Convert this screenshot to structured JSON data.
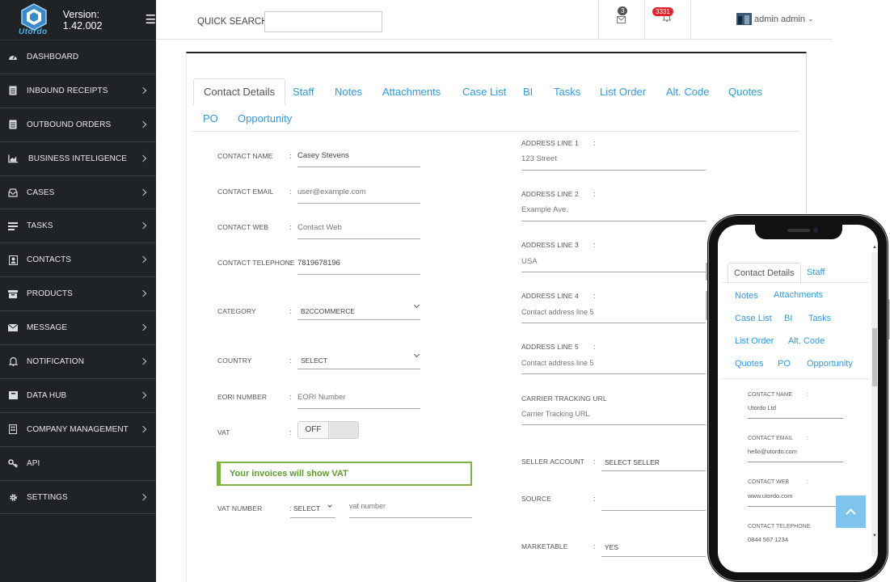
{
  "app": {
    "name": "Utordo",
    "version": "Version: 1.42.002"
  },
  "sidebar": {
    "items": [
      {
        "label": "DASHBOARD",
        "icon": "dashboard-icon"
      },
      {
        "label": "INBOUND RECEIPTS",
        "icon": "document-icon"
      },
      {
        "label": "OUTBOUND ORDERS",
        "icon": "document-icon"
      },
      {
        "label": "BUSINESS INTELIGENCE",
        "icon": "chart-icon"
      },
      {
        "label": "CASES",
        "icon": "inbox-icon"
      },
      {
        "label": "TASKS",
        "icon": "tasks-icon"
      },
      {
        "label": "CONTACTS",
        "icon": "contact-icon"
      },
      {
        "label": "PRODUCTS",
        "icon": "product-icon"
      },
      {
        "label": "MESSAGE",
        "icon": "envelope-icon"
      },
      {
        "label": "NOTIFICATION",
        "icon": "bell-icon"
      },
      {
        "label": "DATA HUB",
        "icon": "database-icon"
      },
      {
        "label": "COMPANY MANAGEMENT",
        "icon": "building-icon"
      },
      {
        "label": "API",
        "icon": "key-icon"
      },
      {
        "label": "SETTINGS",
        "icon": "gear-icon"
      }
    ]
  },
  "topbar": {
    "search_label": "QUICK SEARCH :",
    "search_value": "",
    "mail_count": "3",
    "notif_count": "3331",
    "user_name": "admin admin"
  },
  "tabs": [
    "Contact Details",
    "Staff",
    "Notes",
    "Attachments",
    "Case List",
    "BI",
    "Tasks",
    "List Order",
    "Alt. Code",
    "Quotes",
    "PO",
    "Opportunity"
  ],
  "form_left": {
    "contact_name": {
      "label": "CONTACT NAME",
      "value": "Casey Stevens"
    },
    "contact_email": {
      "label": "CONTACT EMAIL",
      "placeholder": "user@example.com"
    },
    "contact_web": {
      "label": "CONTACT WEB",
      "placeholder": "Contact Web"
    },
    "contact_telephone": {
      "label": "CONTACT TELEPHONE",
      "value": "7819678196"
    },
    "category": {
      "label": "CATEGORY",
      "value": "B2CCOMMERCE"
    },
    "country": {
      "label": "COUNTRY",
      "value": "SELECT"
    },
    "eori": {
      "label": "EORI NUMBER",
      "placeholder": "EORI Number"
    },
    "vat": {
      "label": "VAT",
      "toggle": "OFF"
    },
    "vat_note": "Your invoices will show VAT",
    "vat_number": {
      "label": "VAT NUMBER",
      "select": "SELECT",
      "placeholder": "vat number"
    }
  },
  "form_right": {
    "addr1": {
      "label": "ADDRESS LINE 1",
      "value": "123 Street"
    },
    "addr2": {
      "label": "ADDRESS LINE 2",
      "value": "Example Ave."
    },
    "addr3": {
      "label": "ADDRESS LINE 3",
      "value": "USA"
    },
    "addr4": {
      "label": "ADDRESS LINE 4",
      "placeholder": "Contact address line 5"
    },
    "addr5": {
      "label": "ADDRESS LINE 5",
      "placeholder": "Contact address line 5"
    },
    "tracking": {
      "label": "CARRIER TRACKING URL",
      "placeholder": "Carrier Tracking URL"
    },
    "seller": {
      "label": "SELLER ACCOUNT",
      "value": "SELECT SELLER"
    },
    "source": {
      "label": "SOURCE",
      "value": ""
    },
    "marketable": {
      "label": "MARKETABLE",
      "value": "YES"
    }
  },
  "phone": {
    "tabs": [
      "Contact Details",
      "Staff",
      "Notes",
      "Attachments",
      "Case List",
      "BI",
      "Tasks",
      "List Order",
      "Alt. Code",
      "Quotes",
      "PO",
      "Opportunity"
    ],
    "fields": [
      {
        "label": "CONTACT NAME",
        "value": "Utordo Ltd"
      },
      {
        "label": "CONTACT EMAIL",
        "value": "hello@utordo.com"
      },
      {
        "label": "CONTACT WEB",
        "value": "www.utordo.com"
      },
      {
        "label": "CONTACT TELEPHONE",
        "value": "0844 567 1234"
      }
    ]
  },
  "colors": {
    "accent": "#2e9be0",
    "sidebar": "#1f2326",
    "vat_note": "#7cb342",
    "badge": "#e0262c"
  }
}
